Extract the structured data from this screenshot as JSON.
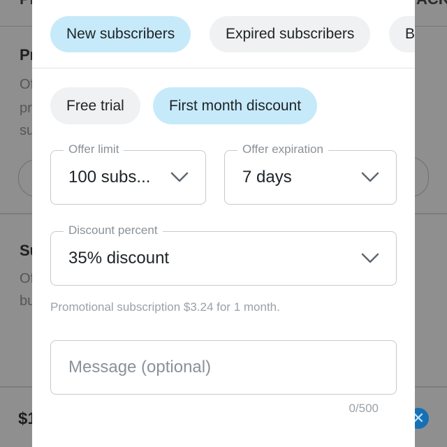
{
  "background": {
    "top_left_text": "PR",
    "top_right_text": "ACK",
    "section1_title": "Pr",
    "section1_lines": [
      "Of",
      "pr",
      "su"
    ],
    "section2_title": "Su",
    "section2_lines": [
      "Of",
      "bu"
    ],
    "price_text": "$1",
    "close_icon": "close-icon"
  },
  "tabs": [
    {
      "label": "New subscribers",
      "selected": true
    },
    {
      "label": "Expired subscribers",
      "selected": false
    },
    {
      "label": "B",
      "selected": false
    }
  ],
  "offer_types": [
    {
      "label": "Free trial",
      "selected": false
    },
    {
      "label": "First month discount",
      "selected": true
    }
  ],
  "offer_limit": {
    "label": "Offer limit",
    "value": "100 subs..."
  },
  "offer_expiration": {
    "label": "Offer expiration",
    "value": "7 days"
  },
  "discount_percent": {
    "label": "Discount percent",
    "value": "35% discount"
  },
  "hint": "Promotional subscription $3.24 for 1 month.",
  "message": {
    "placeholder": "Message (optional)",
    "value": "",
    "counter": "0/500"
  },
  "colors": {
    "selected_chip": "#c7eafa",
    "unselected_chip": "#eff1f2",
    "accent": "#1670b3"
  }
}
